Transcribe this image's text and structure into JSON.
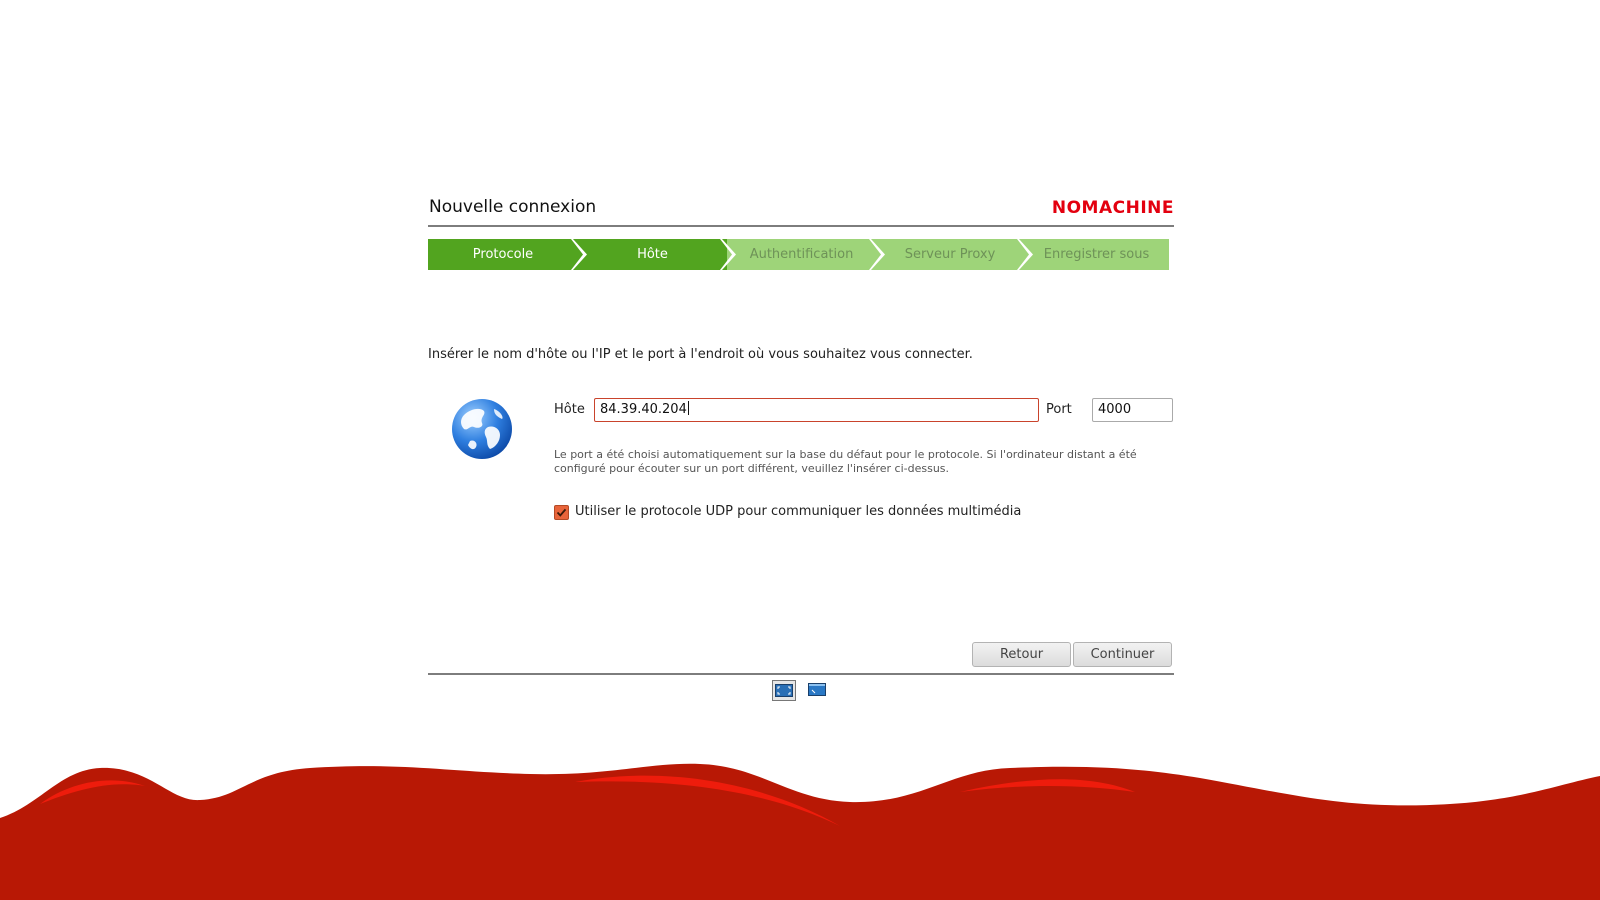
{
  "dialog": {
    "title": "Nouvelle connexion",
    "logo": "NOMACHINE"
  },
  "steps": [
    {
      "label": "Protocole",
      "state": "done"
    },
    {
      "label": "Hôte",
      "state": "done"
    },
    {
      "label": "Authentification",
      "state": "pending"
    },
    {
      "label": "Serveur Proxy",
      "state": "pending"
    },
    {
      "label": "Enregistrer sous",
      "state": "pending"
    }
  ],
  "form": {
    "instruction": "Insérer le nom d'hôte ou l'IP et le port à l'endroit où vous souhaitez vous connecter.",
    "host_label": "Hôte",
    "host_value": "84.39.40.204",
    "port_label": "Port",
    "port_value": "4000",
    "hint": "Le port a été choisi automatiquement sur la base du défaut pour le protocole. Si l'ordinateur distant a été configuré pour écouter sur un port différent, veuillez l'insérer ci-dessus.",
    "udp_checked": true,
    "udp_label": "Utiliser le protocole UDP pour communiquer les données multimédia"
  },
  "buttons": {
    "back": "Retour",
    "continue": "Continuer"
  },
  "view_toggle": {
    "icons": [
      "fullscreen-view-icon",
      "window-view-icon"
    ],
    "active": "fullscreen-view-icon"
  },
  "colors": {
    "step_done": "#52a41f",
    "step_pending": "#9ed479",
    "brand_red": "#e3000f",
    "wave_red": "#b81805",
    "accent_orange": "#e8643a"
  }
}
